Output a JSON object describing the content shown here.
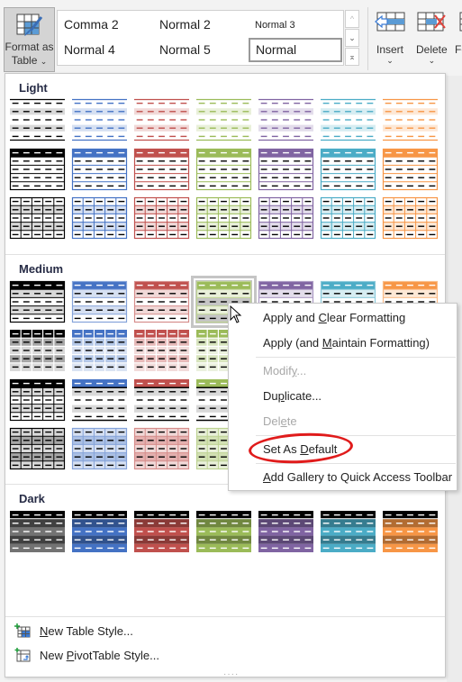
{
  "ribbon": {
    "format_as_table": {
      "line1": "Format as",
      "line2": "Table",
      "chevron": "⌄",
      "icon": "format-as-table-icon"
    },
    "cell_styles": [
      {
        "label": "Comma 2",
        "size": "normal"
      },
      {
        "label": "Normal 2",
        "size": "normal"
      },
      {
        "label": "Normal 3",
        "size": "small"
      },
      {
        "label": "Normal 4",
        "size": "normal"
      },
      {
        "label": "Normal 5",
        "size": "normal"
      },
      {
        "label": "Normal",
        "size": "normal",
        "selected": true
      }
    ],
    "scroll": {
      "up": "^",
      "down": "⌄",
      "more": "⌅"
    },
    "insert": {
      "label": "Insert",
      "chevron": "⌄",
      "icon": "insert-cells-icon"
    },
    "delete": {
      "label": "Delete",
      "chevron": "⌄",
      "icon": "delete-cells-icon"
    },
    "format_partial": {
      "label": "Fo",
      "icon": "format-cells-icon"
    }
  },
  "colors": {
    "black": "#000000",
    "gray": "#a5a5a5",
    "blue": "#4472c4",
    "red": "#c0504d",
    "green": "#9bbb59",
    "purple": "#8064a2",
    "aqua": "#4bacc6",
    "orange": "#f79646",
    "highlight_ring": "#e01b1b",
    "section_title": "#262b45"
  },
  "gallery": {
    "sections": [
      {
        "title": "Light",
        "rows": [
          {
            "kind": "light-banded",
            "themes": [
              "black",
              "blue",
              "red",
              "green",
              "purple",
              "aqua",
              "orange"
            ]
          },
          {
            "kind": "light-header",
            "themes": [
              "black",
              "blue",
              "red",
              "green",
              "purple",
              "aqua",
              "orange"
            ]
          },
          {
            "kind": "light-grid",
            "themes": [
              "black",
              "blue",
              "red",
              "green",
              "purple",
              "aqua",
              "orange"
            ]
          }
        ]
      },
      {
        "title": "Medium",
        "rows": [
          {
            "kind": "medium-header",
            "themes": [
              "black",
              "blue",
              "red",
              "green",
              "purple",
              "aqua",
              "orange"
            ],
            "hovered_index": 3
          },
          {
            "kind": "medium-solid",
            "themes": [
              "black",
              "blue",
              "red",
              "green",
              "purple",
              "aqua",
              "orange"
            ]
          },
          {
            "kind": "medium-gray-band",
            "themes": [
              "black",
              "blue",
              "red",
              "green",
              "purple",
              "aqua",
              "orange"
            ]
          },
          {
            "kind": "medium-grid-fill",
            "themes": [
              "black",
              "blue",
              "red",
              "green",
              "purple",
              "aqua",
              "orange"
            ]
          }
        ]
      },
      {
        "title": "Dark",
        "rows": [
          {
            "kind": "dark",
            "themes": [
              "black",
              "blue",
              "red",
              "green",
              "purple",
              "aqua",
              "orange"
            ]
          },
          {
            "kind": "dark-mixed",
            "themes": [
              "black-gray",
              "red-blue",
              "purple-green",
              "orange-aqua"
            ]
          }
        ]
      }
    ],
    "footer": [
      {
        "pre": "",
        "accel": "N",
        "post": "ew Table Style...",
        "icon": "new-table-style-icon"
      },
      {
        "pre": "New ",
        "accel": "P",
        "post": "ivotTable Style...",
        "icon": "new-pivottable-style-icon"
      }
    ],
    "resize_grip": "····"
  },
  "context_menu": {
    "items": [
      {
        "pre": "Apply and ",
        "accel": "C",
        "post": "lear Formatting",
        "disabled": false
      },
      {
        "pre": "Apply (and ",
        "accel": "M",
        "post": "aintain Formatting)",
        "disabled": false
      },
      {
        "pre": "Modif",
        "accel": "y",
        "post": "...",
        "disabled": true
      },
      {
        "pre": "Du",
        "accel": "p",
        "post": "licate...",
        "disabled": false
      },
      {
        "pre": "Del",
        "accel": "e",
        "post": "te",
        "disabled": true
      },
      {
        "pre": "Set As ",
        "accel": "D",
        "post": "efault",
        "disabled": false,
        "highlighted": true
      },
      {
        "pre": "",
        "accel": "A",
        "post": "dd Gallery to Quick Access Toolbar",
        "disabled": false
      }
    ]
  }
}
